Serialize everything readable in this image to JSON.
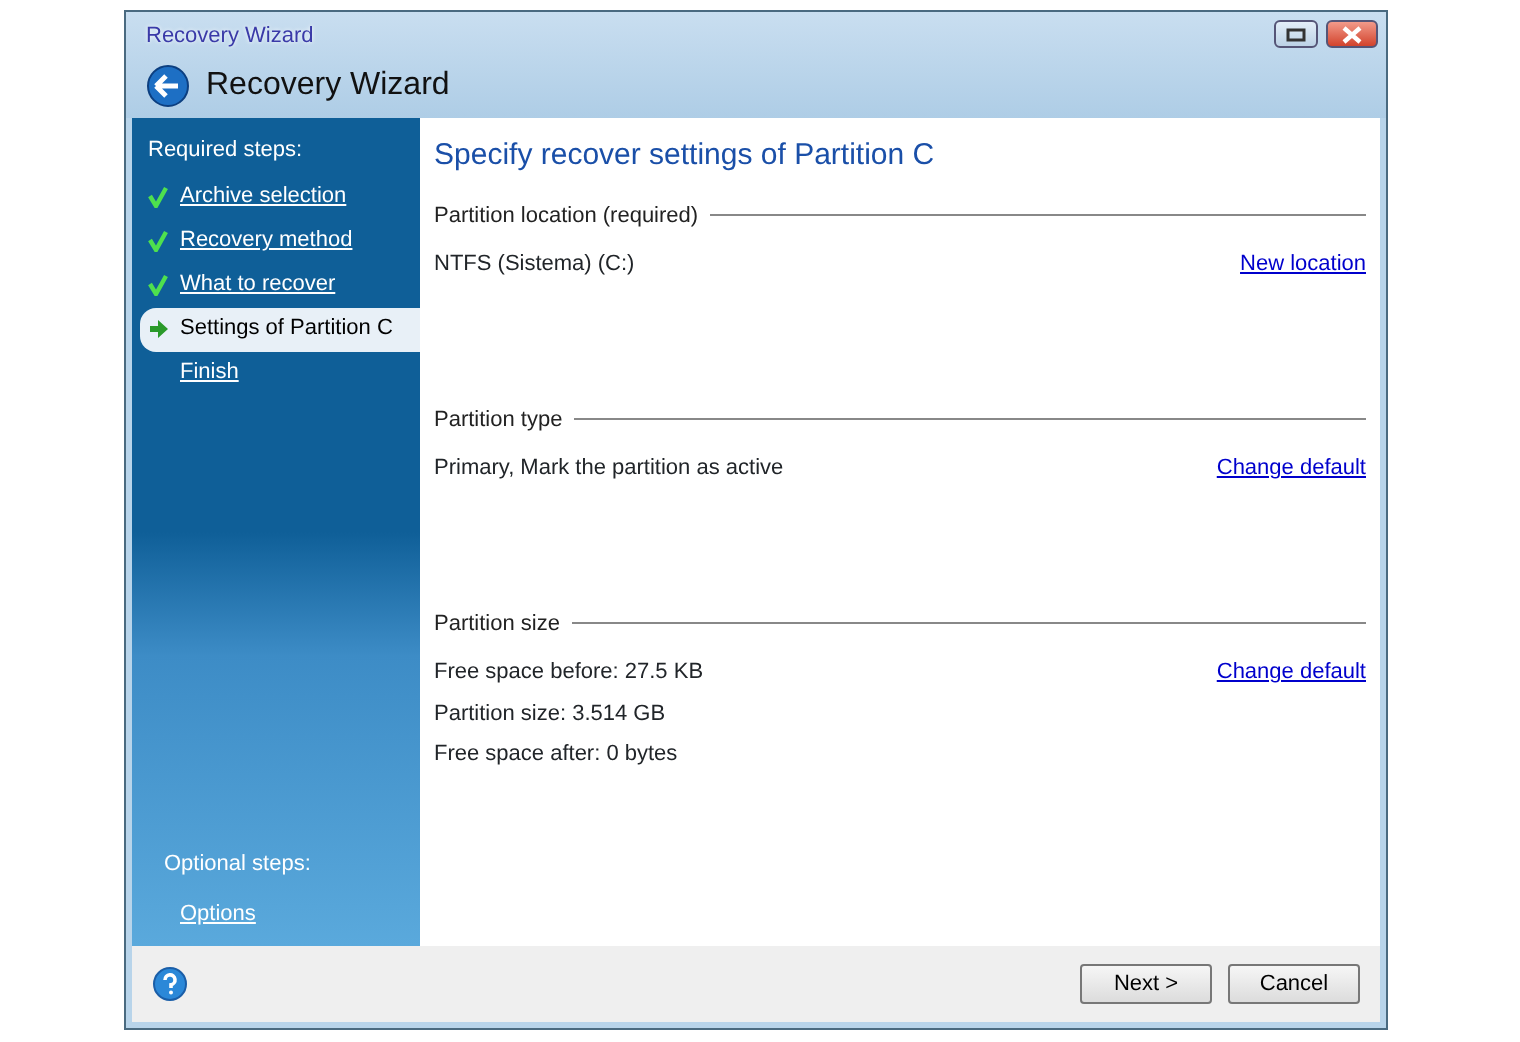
{
  "window": {
    "title": "Recovery Wizard",
    "heading": "Recovery Wizard"
  },
  "sidebar": {
    "required_label": "Required steps:",
    "steps": [
      {
        "label": "Archive selection",
        "kind": "done",
        "selected": false
      },
      {
        "label": "Recovery method",
        "kind": "done",
        "selected": false
      },
      {
        "label": "What to recover",
        "kind": "done",
        "selected": false
      },
      {
        "label": "Settings of Partition C",
        "kind": "current",
        "selected": true
      },
      {
        "label": "Finish",
        "kind": "pending",
        "selected": false
      }
    ],
    "optional_label": "Optional steps:",
    "optional_steps": [
      {
        "label": "Options"
      }
    ]
  },
  "content": {
    "title": "Specify recover settings of Partition C",
    "sections": [
      {
        "heading": "Partition location (required)",
        "lines": [
          "NTFS (Sistema) (C:)"
        ],
        "link": "New location"
      },
      {
        "heading": "Partition type",
        "lines": [
          "Primary, Mark the partition as active"
        ],
        "link": "Change default"
      },
      {
        "heading": "Partition size",
        "lines": [
          "Free space before: 27.5 KB",
          "Partition size: 3.514 GB",
          "Free space after: 0 bytes"
        ],
        "link": "Change default"
      }
    ]
  },
  "buttons": [
    "Next >",
    "Cancel"
  ]
}
